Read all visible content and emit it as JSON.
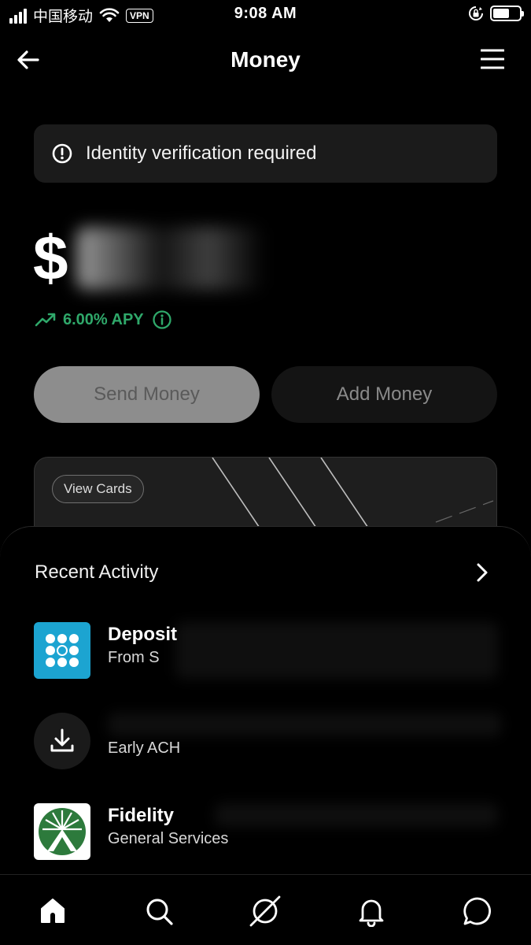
{
  "status_bar": {
    "carrier": "中国移动",
    "vpn": "VPN",
    "time": "9:08 AM"
  },
  "nav": {
    "title": "Money",
    "back_icon": "arrow-left-icon",
    "menu_icon": "hamburger-menu-icon"
  },
  "alert": {
    "icon": "exclamation-circle-icon",
    "text": "Identity verification required"
  },
  "balance": {
    "symbol": "$"
  },
  "apy": {
    "icon": "trending-up-icon",
    "text": "6.00% APY",
    "info_icon": "info-icon"
  },
  "actions": {
    "send_label": "Send Money",
    "add_label": "Add Money"
  },
  "card": {
    "chip_label": "View Cards"
  },
  "activity": {
    "title": "Recent Activity",
    "items": [
      {
        "title": "Deposit",
        "subtitle": "From S",
        "icon": "deposit-dots-icon"
      },
      {
        "title": "",
        "subtitle": "Early ACH",
        "icon": "download-icon"
      },
      {
        "title": "Fidelity",
        "subtitle": "General Services",
        "icon": "fidelity-logo-icon"
      }
    ]
  },
  "tabbar": {
    "tabs": [
      "home-icon",
      "search-icon",
      "orbit-icon",
      "bell-icon",
      "chat-icon"
    ]
  },
  "colors": {
    "background": "#000000",
    "accent_green": "#2fa86a",
    "deposit_blue": "#1ca4d1",
    "alert_bg": "#1b1b1b"
  }
}
